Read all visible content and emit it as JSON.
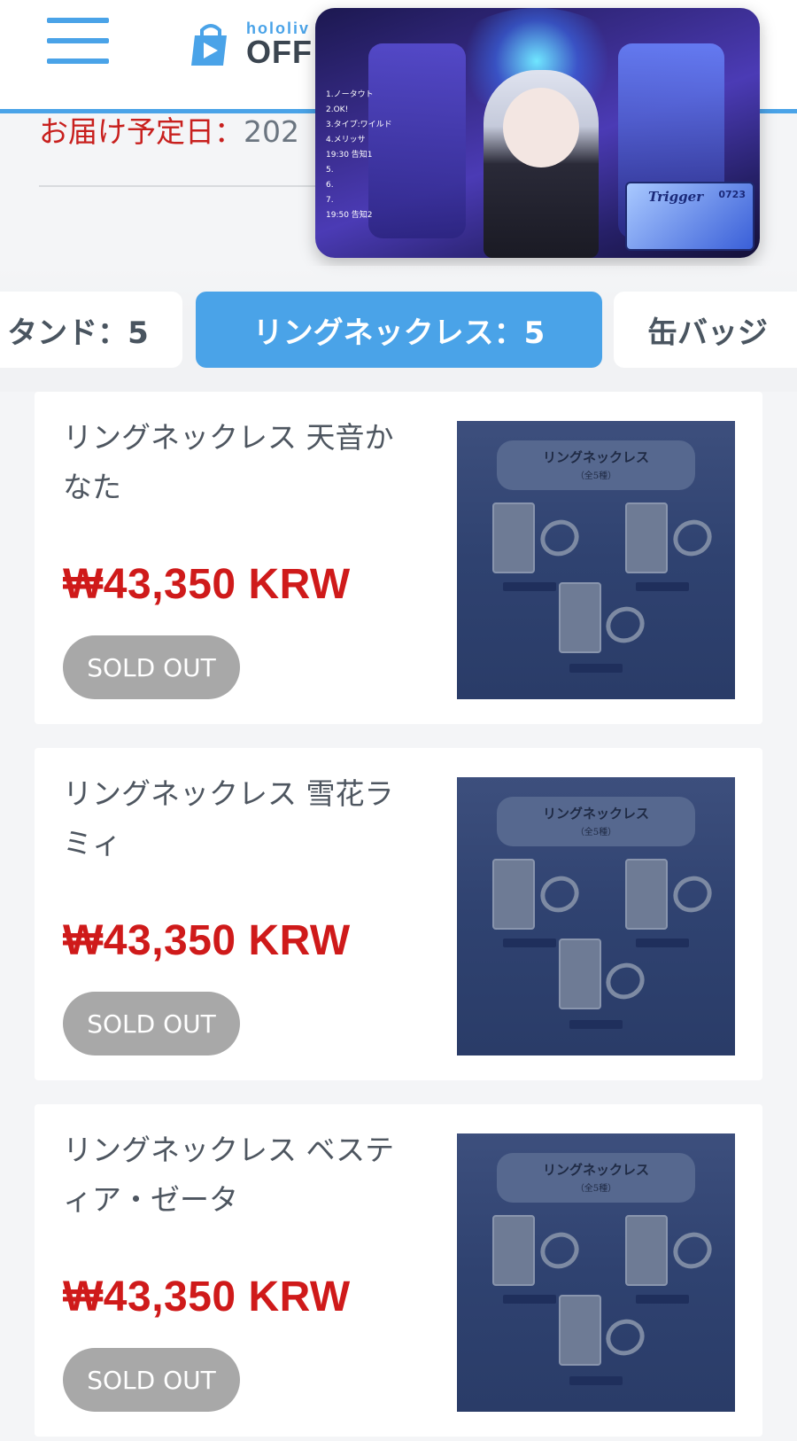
{
  "header": {
    "logo_top": "hololiv",
    "logo_bottom": "OFF",
    "delivery_label": "お届け予定日：",
    "delivery_value": "202"
  },
  "video": {
    "setlist": [
      "1.ノータウト",
      "2.OK!",
      "3.タイプ:ワイルド",
      "4.メリッサ",
      "19:30 告知1",
      "5.",
      "6.",
      "7.",
      "19:50 告知2"
    ],
    "promo_title": "Trigger",
    "promo_date": "0723"
  },
  "tabs": [
    {
      "label": "タンド：5"
    },
    {
      "label": "リングネックレス：5"
    },
    {
      "label": "缶バッジ"
    }
  ],
  "products": [
    {
      "name": "リングネックレス 天音かなた",
      "price": "₩43,350 KRW",
      "status": "SOLD OUT",
      "thumb_title": "リングネックレス",
      "thumb_sub": "（全5種）"
    },
    {
      "name": "リングネックレス 雪花ラミィ",
      "price": "₩43,350 KRW",
      "status": "SOLD OUT",
      "thumb_title": "リングネックレス",
      "thumb_sub": "（全5種）"
    },
    {
      "name": "リングネックレス ベスティア・ゼータ",
      "price": "₩43,350 KRW",
      "status": "SOLD OUT",
      "thumb_title": "リングネックレス",
      "thumb_sub": "（全5種）"
    }
  ],
  "colors": {
    "accent": "#4aa3e8",
    "price": "#cf1a1a",
    "sold_out": "#a8a8a8",
    "delivery": "#c8201e"
  }
}
